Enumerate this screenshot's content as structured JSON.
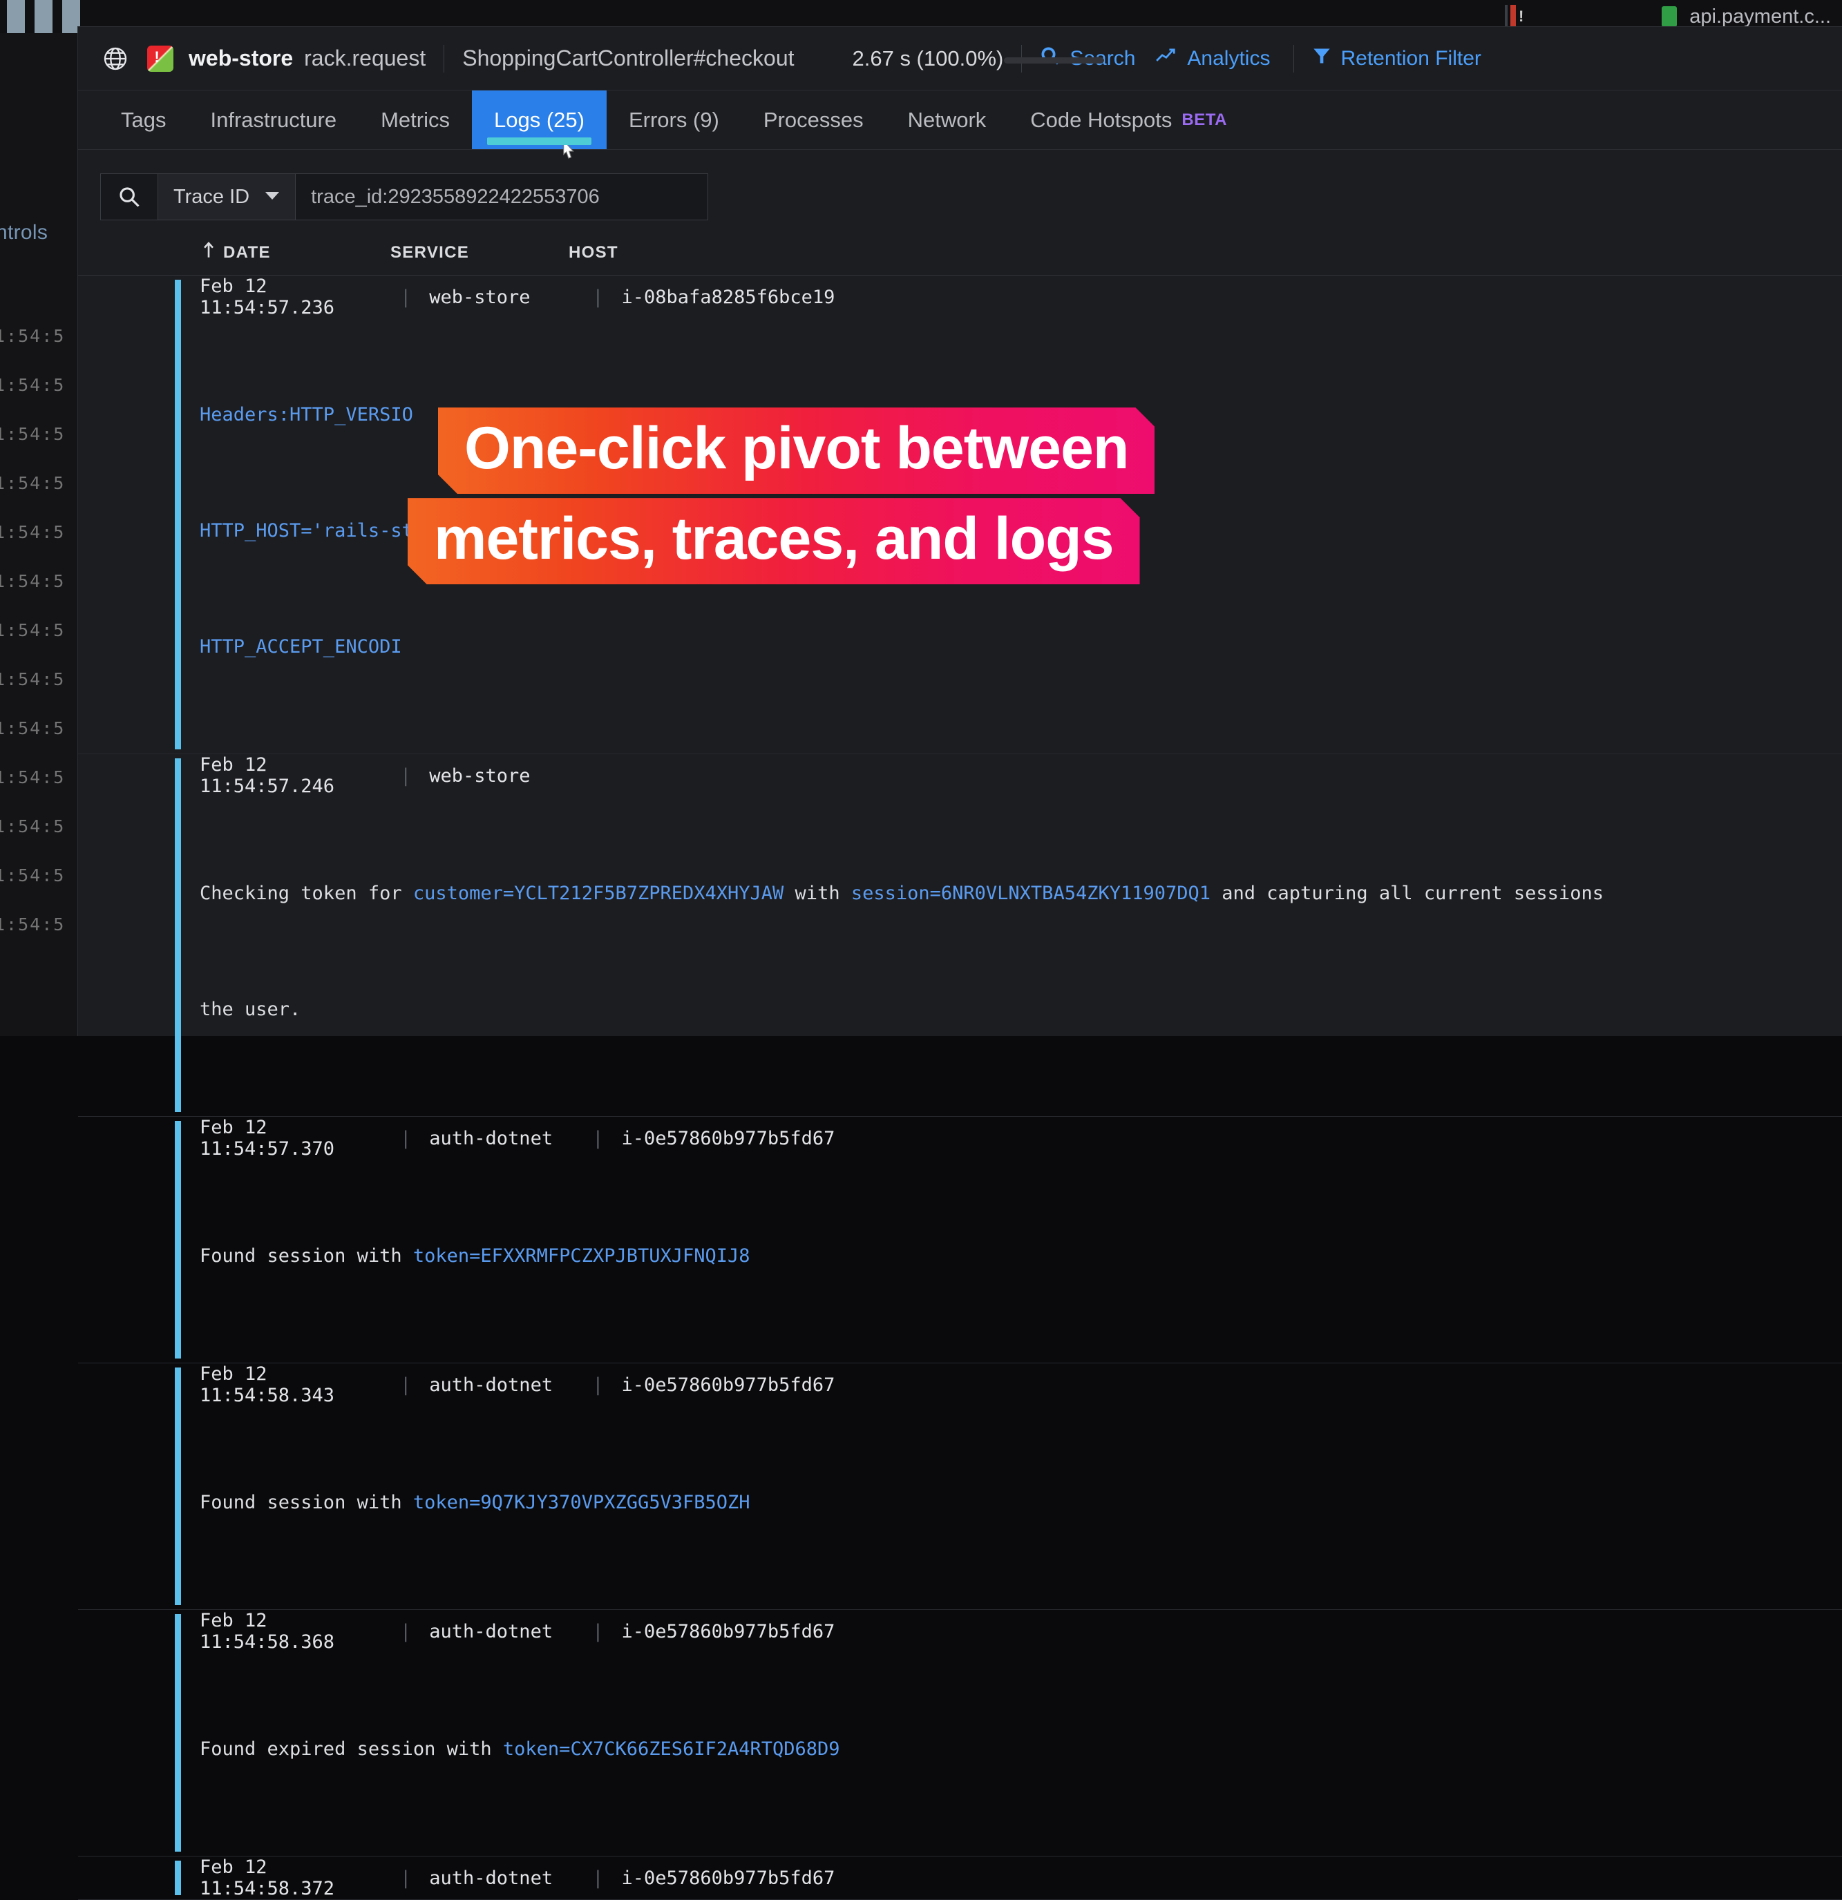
{
  "background": {
    "controls_label": "ntrols",
    "left_timestamps": [
      "1:54:5",
      "1:54:5",
      "1:54:5",
      "1:54:5",
      "1:54:5",
      "1:54:5",
      "1:54:5",
      "1:54:5",
      "1:54:5",
      "1:54:5",
      "1:54:5",
      "1:54:5",
      "1:54:5"
    ],
    "top_strip": {
      "alert_glyph": "!",
      "host_label": "api.payment.c...",
      "status_color": "#2f9e44",
      "alert_color": "#c0392b"
    }
  },
  "header": {
    "globe_icon": "globe-icon",
    "service_logo_icon": "datadog-service-logo-icon",
    "service": "web-store",
    "operation": "rack.request",
    "resource": "ShoppingCartController#checkout",
    "duration": "2.67 s (100.0%)",
    "actions": [
      {
        "icon": "search-icon",
        "label": "Search"
      },
      {
        "icon": "analytics-icon",
        "label": "Analytics"
      },
      {
        "icon": "filter-icon",
        "label": "Retention Filter"
      }
    ],
    "action_color": "#4b9ffa"
  },
  "tabs": [
    {
      "label": "Tags",
      "active": false
    },
    {
      "label": "Infrastructure",
      "active": false
    },
    {
      "label": "Metrics",
      "active": false
    },
    {
      "label": "Logs (25)",
      "active": true
    },
    {
      "label": "Errors (9)",
      "active": false
    },
    {
      "label": "Processes",
      "active": false
    },
    {
      "label": "Network",
      "active": false
    },
    {
      "label": "Code Hotspots",
      "active": false,
      "badge": "BETA"
    }
  ],
  "tab_active_color": "#2a7fe8",
  "tab_underline_color": "#4ecdd6",
  "search": {
    "icon": "search-icon",
    "facet_label": "Trace ID",
    "facet_caret_icon": "chevron-down-icon",
    "query": "trace_id:2923558922422553706"
  },
  "log_table": {
    "columns": [
      "DATE",
      "SERVICE",
      "HOST"
    ],
    "sort_icon": "sort-ascending-arrow-icon",
    "rows": [
      {
        "date": "Feb 12 11:54:57.236",
        "service": "web-store",
        "host": "i-08bafa8285f6bce19",
        "body_lines": [
          {
            "segments": [
              {
                "text": "Headers:HTTP_VERSIO",
                "style": "attr"
              }
            ]
          },
          {
            "segments": [
              {
                "text": "HTTP_HOST='rails-sto",
                "style": "attr"
              }
            ]
          },
          {
            "segments": [
              {
                "text": "HTTP_ACCEPT_ENCODI",
                "style": "attr"
              }
            ]
          }
        ]
      },
      {
        "date": "Feb 12 11:54:57.246",
        "service": "web-store",
        "host": "",
        "body_lines": [
          {
            "segments": [
              {
                "text": "Checking token for ",
                "style": "plain"
              },
              {
                "text": "customer=YCLT212F5B7ZPREDX4XHYJAW",
                "style": "kv"
              },
              {
                "text": " with ",
                "style": "plain"
              },
              {
                "text": "session=6NR0VLNXTBA54ZKY11907DQ1",
                "style": "kv"
              },
              {
                "text": " and capturing all current sessions",
                "style": "plain"
              }
            ]
          },
          {
            "segments": [
              {
                "text": "the user.",
                "style": "plain"
              }
            ]
          }
        ]
      },
      {
        "date": "Feb 12 11:54:57.370",
        "service": "auth-dotnet",
        "host": "i-0e57860b977b5fd67",
        "body_lines": [
          {
            "segments": [
              {
                "text": "Found session with ",
                "style": "plain"
              },
              {
                "text": "token=EFXXRMFPCZXPJBTUXJFNQIJ8",
                "style": "kv"
              }
            ]
          }
        ]
      },
      {
        "date": "Feb 12 11:54:58.343",
        "service": "auth-dotnet",
        "host": "i-0e57860b977b5fd67",
        "body_lines": [
          {
            "segments": [
              {
                "text": "Found session with ",
                "style": "plain"
              },
              {
                "text": "token=9Q7KJY370VPXZGG5V3FB5OZH",
                "style": "kv"
              }
            ]
          }
        ]
      },
      {
        "date": "Feb 12 11:54:58.368",
        "service": "auth-dotnet",
        "host": "i-0e57860b977b5fd67",
        "body_lines": [
          {
            "segments": [
              {
                "text": "Found expired session with ",
                "style": "plain"
              },
              {
                "text": "token=CX7CK66ZES6IF2A4RTQD68D9",
                "style": "kv"
              }
            ]
          }
        ]
      },
      {
        "date": "Feb 12 11:54:58.372",
        "service": "auth-dotnet",
        "host": "i-0e57860b977b5fd67",
        "body_lines": []
      }
    ]
  },
  "banner": {
    "line1": "One-click pivot between",
    "line2": "metrics, traces, and logs",
    "gradient_start": "#f26522",
    "gradient_end": "#ee0d6e"
  }
}
